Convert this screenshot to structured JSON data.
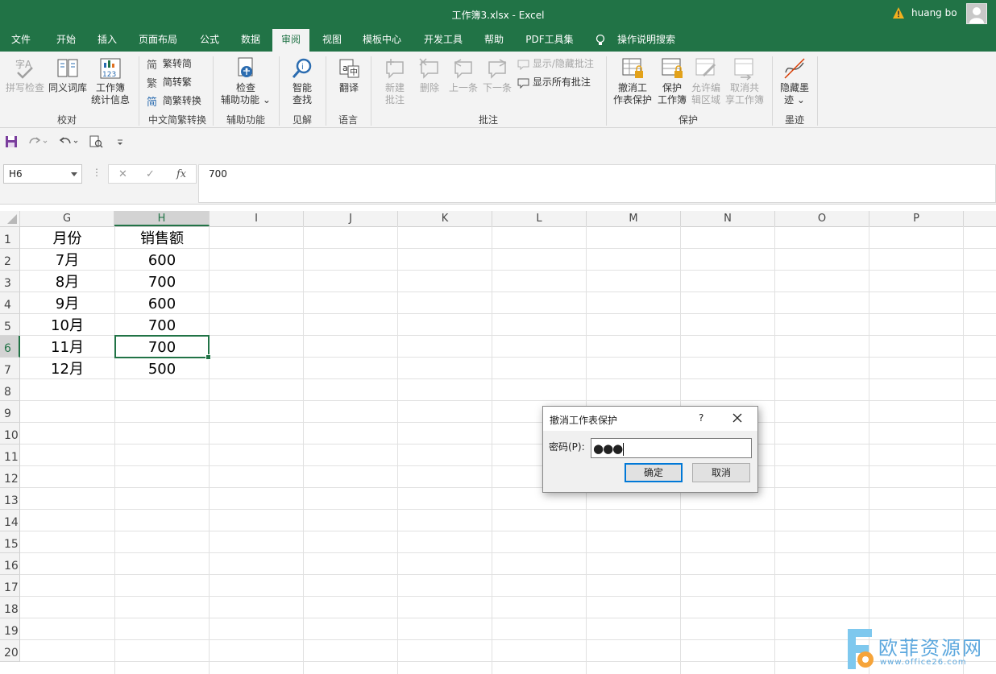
{
  "window": {
    "title": "工作簿3.xlsx  -  Excel",
    "user": "huang bo"
  },
  "tabs": [
    "文件",
    "开始",
    "插入",
    "页面布局",
    "公式",
    "数据",
    "审阅",
    "视图",
    "模板中心",
    "开发工具",
    "帮助",
    "PDF工具集",
    "操作说明搜索"
  ],
  "active_tab": "审阅",
  "ribbon": {
    "proofing": {
      "spell": "拼写检查",
      "thesaurus": "同义词库",
      "stats_l1": "工作簿",
      "stats_l2": "统计信息",
      "group": "校对"
    },
    "chinese": {
      "t2s": "繁转简",
      "s2t": "简转繁",
      "convert": "简繁转换",
      "group": "中文简繁转换"
    },
    "accessibility": {
      "l1": "检查",
      "l2": "辅助功能",
      "group": "辅助功能"
    },
    "insights": {
      "l1": "智能",
      "l2": "查找",
      "group": "见解"
    },
    "language": {
      "translate": "翻译",
      "group": "语言"
    },
    "comments": {
      "new_l1": "新建",
      "new_l2": "批注",
      "delete": "删除",
      "prev": "上一条",
      "next": "下一条",
      "show_hide": "显示/隐藏批注",
      "show_all": "显示所有批注",
      "group": "批注"
    },
    "protect": {
      "unprotect_l1": "撤消工",
      "unprotect_l2": "作表保护",
      "wb_l1": "保护",
      "wb_l2": "工作簿",
      "allow_l1": "允许编",
      "allow_l2": "辑区域",
      "unshare_l1": "取消共",
      "unshare_l2": "享工作簿",
      "group": "保护"
    },
    "ink": {
      "l1": "隐藏墨",
      "l2": "迹",
      "group": "墨迹"
    }
  },
  "formula_bar": {
    "name_box": "H6",
    "fx": "fx",
    "value": "700"
  },
  "columns": [
    "G",
    "H",
    "I",
    "J",
    "K",
    "L",
    "M",
    "N",
    "O",
    "P"
  ],
  "rows": [
    "1",
    "2",
    "3",
    "4",
    "5",
    "6",
    "7",
    "8",
    "9",
    "10",
    "11",
    "12",
    "13",
    "14",
    "15",
    "16",
    "17",
    "18",
    "19",
    "20"
  ],
  "sheet": {
    "headers": [
      "月份",
      "销售额"
    ],
    "data": [
      [
        "7月",
        "600"
      ],
      [
        "8月",
        "700"
      ],
      [
        "9月",
        "600"
      ],
      [
        "10月",
        "700"
      ],
      [
        "11月",
        "700"
      ],
      [
        "12月",
        "500"
      ]
    ]
  },
  "selected_cell": "H6",
  "dialog": {
    "title": "撤消工作表保护",
    "help": "?",
    "label": "密码(P):",
    "password_mask": "●●●",
    "ok": "确定",
    "cancel": "取消"
  },
  "watermark": {
    "text": "欧菲资源网",
    "url": "www.office26.com"
  },
  "colors": {
    "excel_green": "#217346",
    "ribbon_bg": "#f3f3f3",
    "dialog_accent": "#0078d7"
  }
}
